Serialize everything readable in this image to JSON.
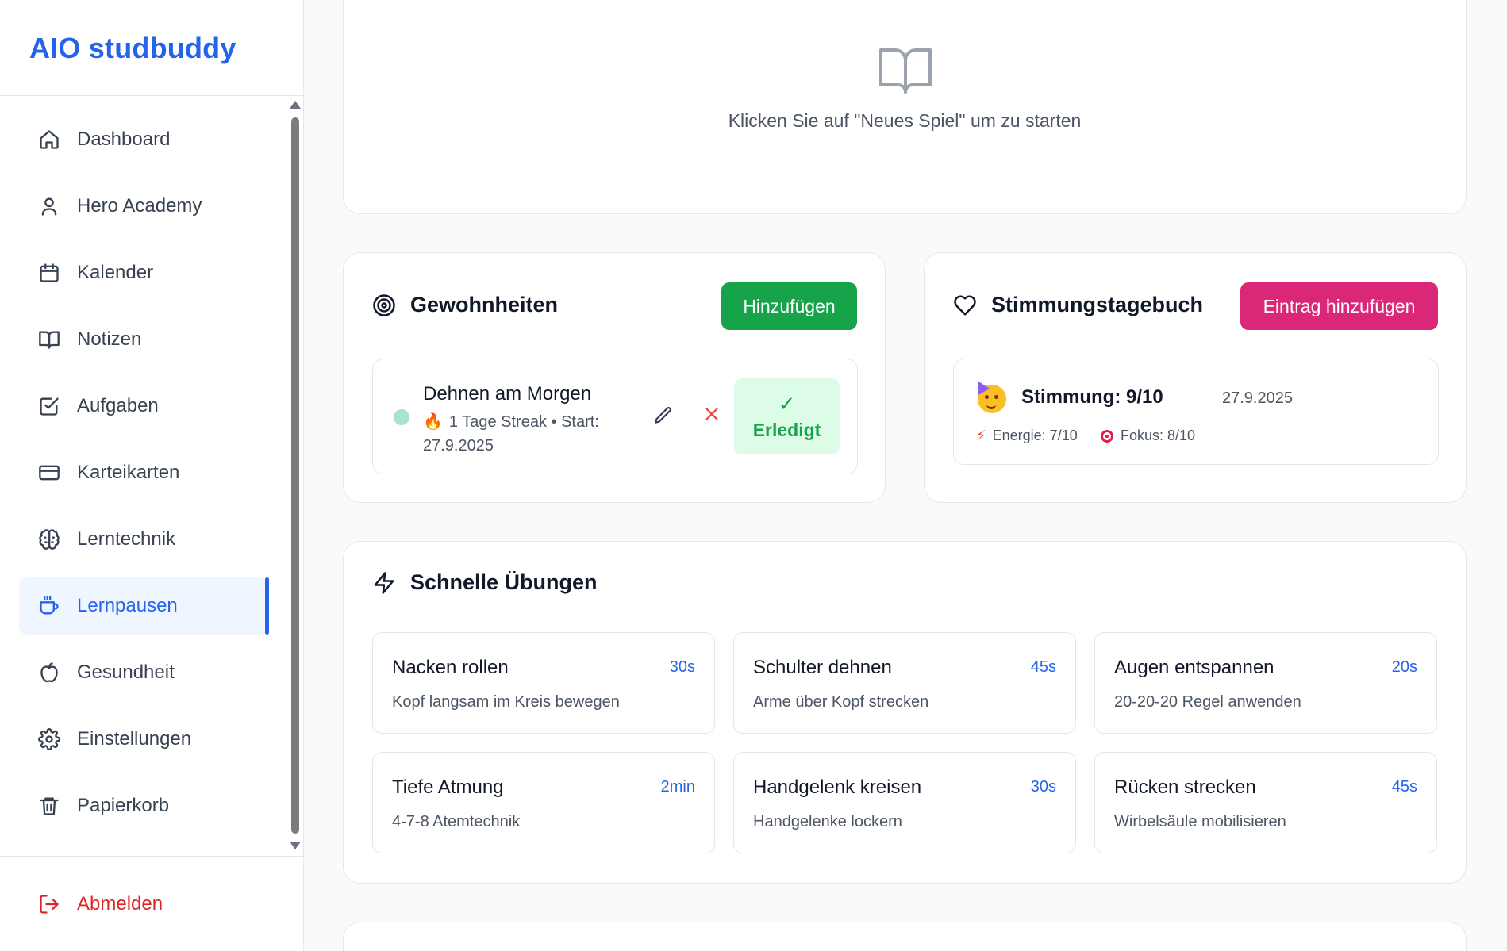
{
  "app": {
    "title": "AIO studbuddy"
  },
  "sidebar": {
    "items": [
      {
        "label": "Dashboard",
        "icon": "home-icon"
      },
      {
        "label": "Hero Academy",
        "icon": "user-icon"
      },
      {
        "label": "Kalender",
        "icon": "calendar-icon"
      },
      {
        "label": "Notizen",
        "icon": "book-icon"
      },
      {
        "label": "Aufgaben",
        "icon": "checkbox-icon"
      },
      {
        "label": "Karteikarten",
        "icon": "card-icon"
      },
      {
        "label": "Lerntechnik",
        "icon": "brain-icon"
      },
      {
        "label": "Lernpausen",
        "icon": "coffee-icon",
        "active": true
      },
      {
        "label": "Gesundheit",
        "icon": "apple-icon"
      },
      {
        "label": "Einstellungen",
        "icon": "gear-icon"
      },
      {
        "label": "Papierkorb",
        "icon": "trash-icon"
      }
    ],
    "logout_label": "Abmelden"
  },
  "game": {
    "hint": "Klicken Sie auf \"Neues Spiel\" um zu starten",
    "icon": "book-open-icon"
  },
  "habits": {
    "title": "Gewohnheiten",
    "add_label": "Hinzufügen",
    "items": [
      {
        "name": "Dehnen am Morgen",
        "meta": "1 Tage Streak • Start: 27.9.2025",
        "done_check": "✓",
        "done_label": "Erledigt"
      }
    ]
  },
  "mood": {
    "title": "Stimmungstagebuch",
    "add_label": "Eintrag hinzufügen",
    "entries": [
      {
        "label": "Stimmung: 9/10",
        "date": "27.9.2025",
        "energy": "Energie: 7/10",
        "focus": "Fokus: 8/10"
      }
    ]
  },
  "exercises": {
    "title": "Schnelle Übungen",
    "items": [
      {
        "name": "Nacken rollen",
        "time": "30s",
        "desc": "Kopf langsam im Kreis bewegen"
      },
      {
        "name": "Schulter dehnen",
        "time": "45s",
        "desc": "Arme über Kopf strecken"
      },
      {
        "name": "Augen entspannen",
        "time": "20s",
        "desc": "20-20-20 Regel anwenden"
      },
      {
        "name": "Tiefe Atmung",
        "time": "2min",
        "desc": "4-7-8 Atemtechnik"
      },
      {
        "name": "Handgelenk kreisen",
        "time": "30s",
        "desc": "Handgelenke lockern"
      },
      {
        "name": "Rücken strecken",
        "time": "45s",
        "desc": "Wirbelsäule mobilisieren"
      }
    ]
  },
  "colors": {
    "brand": "#2563eb",
    "success": "#16a34a",
    "pink": "#db2777",
    "danger": "#dc2626"
  }
}
